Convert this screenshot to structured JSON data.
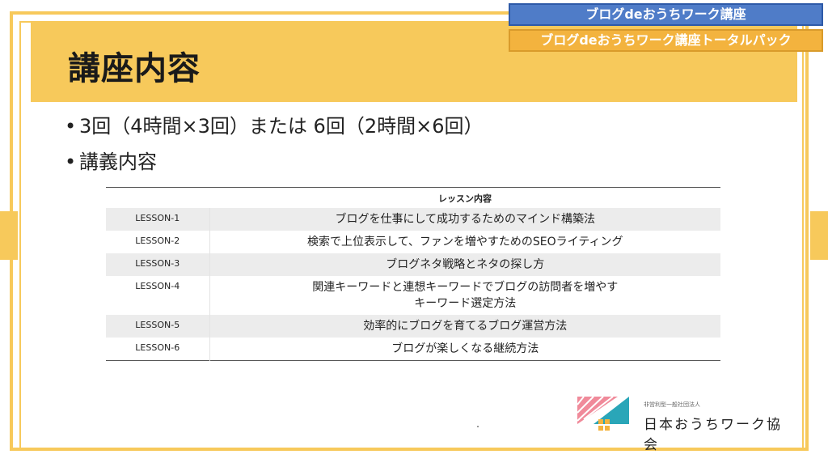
{
  "header": {
    "title": "講座内容",
    "nav": [
      "ブログdeおうちワーク講座",
      "ブログdeおうちワーク講座トータルパック"
    ]
  },
  "bullets": [
    "3回（4時間×3回）または  6回（2時間×6回）",
    "講義内容"
  ],
  "table": {
    "header": [
      "",
      "レッスン内容"
    ],
    "rows": [
      {
        "id": "LESSON-1",
        "lines": [
          "ブログを仕事にして成功するためのマインド構築法"
        ]
      },
      {
        "id": "LESSON-2",
        "lines": [
          "検索で上位表示して、ファンを増やすためのSEOライティング"
        ]
      },
      {
        "id": "LESSON-3",
        "lines": [
          "ブログネタ戦略とネタの探し方"
        ]
      },
      {
        "id": "LESSON-4",
        "lines": [
          "関連キーワードと連想キーワードでブログの訪問者を増やす",
          "キーワード選定方法"
        ]
      },
      {
        "id": "LESSON-5",
        "lines": [
          "効率的にブログを育てるブログ運営方法"
        ]
      },
      {
        "id": "LESSON-6",
        "lines": [
          "ブログが楽しくなる継続方法"
        ]
      }
    ]
  },
  "logo": {
    "small_text": "非営利型一般社団法人",
    "name": "日本おうちワーク協会"
  },
  "colors": {
    "frame": "#f7c95b",
    "nav_blue": "#4f7cc8",
    "nav_gold": "#f3b33e",
    "logo_pink": "#f08a9a",
    "logo_teal": "#2aa6b8"
  }
}
